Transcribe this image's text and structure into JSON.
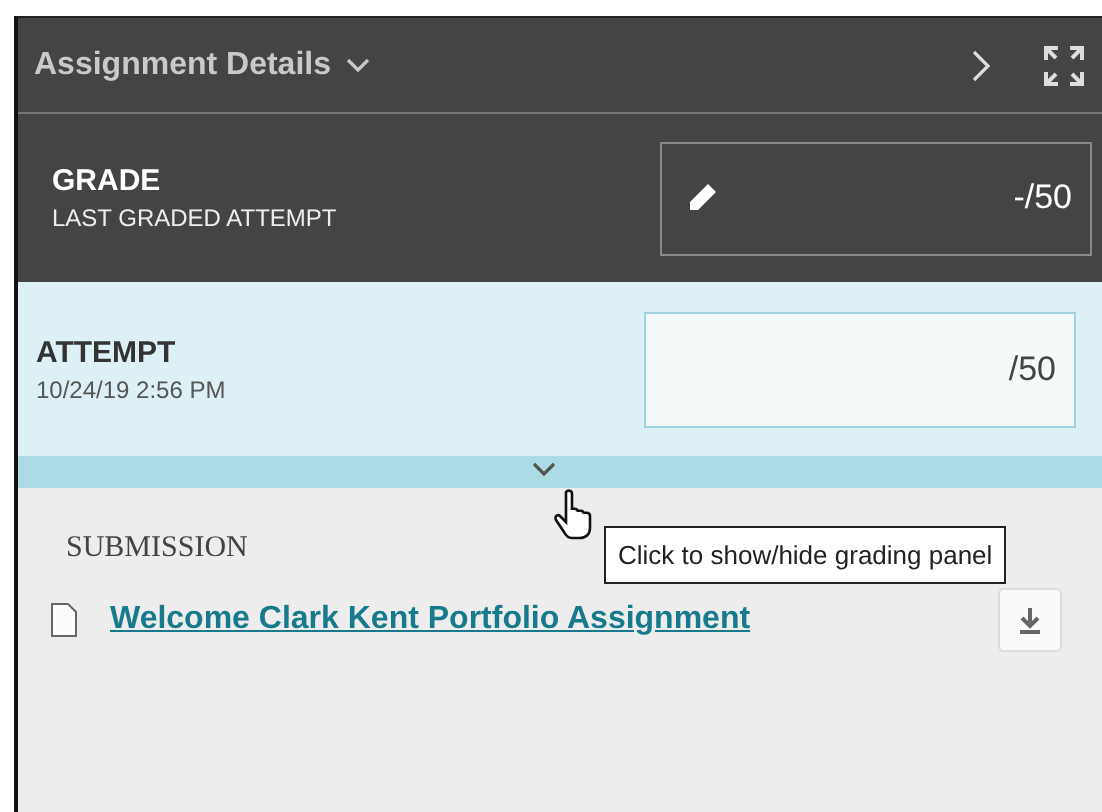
{
  "header": {
    "title": "Assignment Details"
  },
  "grade": {
    "label": "GRADE",
    "sublabel": "LAST GRADED ATTEMPT",
    "value": "-",
    "total": "/50"
  },
  "attempt": {
    "label": "ATTEMPT",
    "date": "10/24/19 2:56 PM",
    "total": "/50"
  },
  "tooltip": "Click to show/hide grading panel",
  "submission": {
    "heading": "SUBMISSION",
    "file": "Welcome Clark Kent Portfolio Assignment"
  }
}
